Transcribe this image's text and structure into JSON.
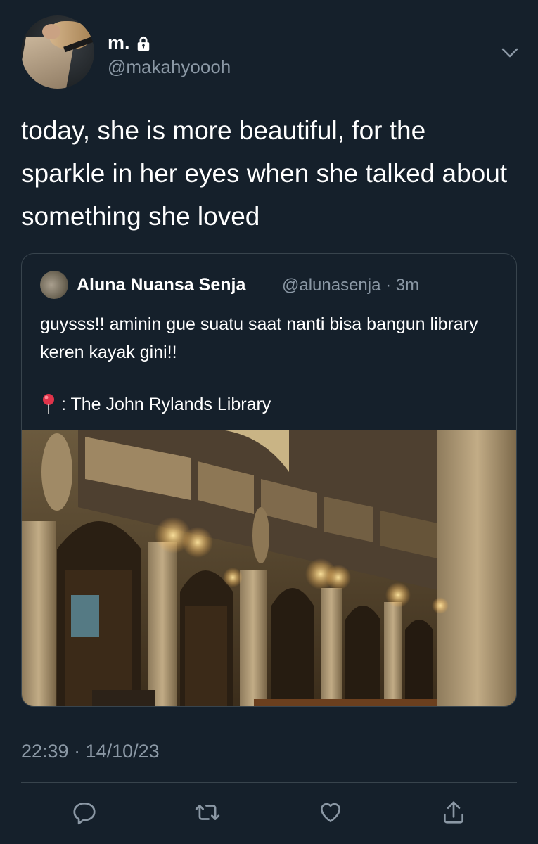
{
  "author": {
    "display_name": "m.",
    "handle": "@makahyoooh",
    "protected": true
  },
  "tweet": {
    "text": "today, she is more beautiful, for the sparkle in her eyes when she talked about something she loved",
    "timestamp": "22:39 · 14/10/23"
  },
  "quote": {
    "display_name": "Aluna Nuansa Senja",
    "handle_time": "@alunasenja · 3m",
    "text": "guysss!! aminin gue suatu saat nanti bisa bangun library keren kayak gini!!",
    "location": ": The John Rylands Library"
  },
  "icons": {
    "lock": "lock-icon",
    "chevron": "chevron-down-icon",
    "pin": "pushpin-icon",
    "reply": "reply-icon",
    "retweet": "retweet-icon",
    "like": "heart-icon",
    "share": "share-icon"
  },
  "colors": {
    "background": "#15202b",
    "secondary_text": "#8b98a5",
    "border": "#38444d"
  }
}
